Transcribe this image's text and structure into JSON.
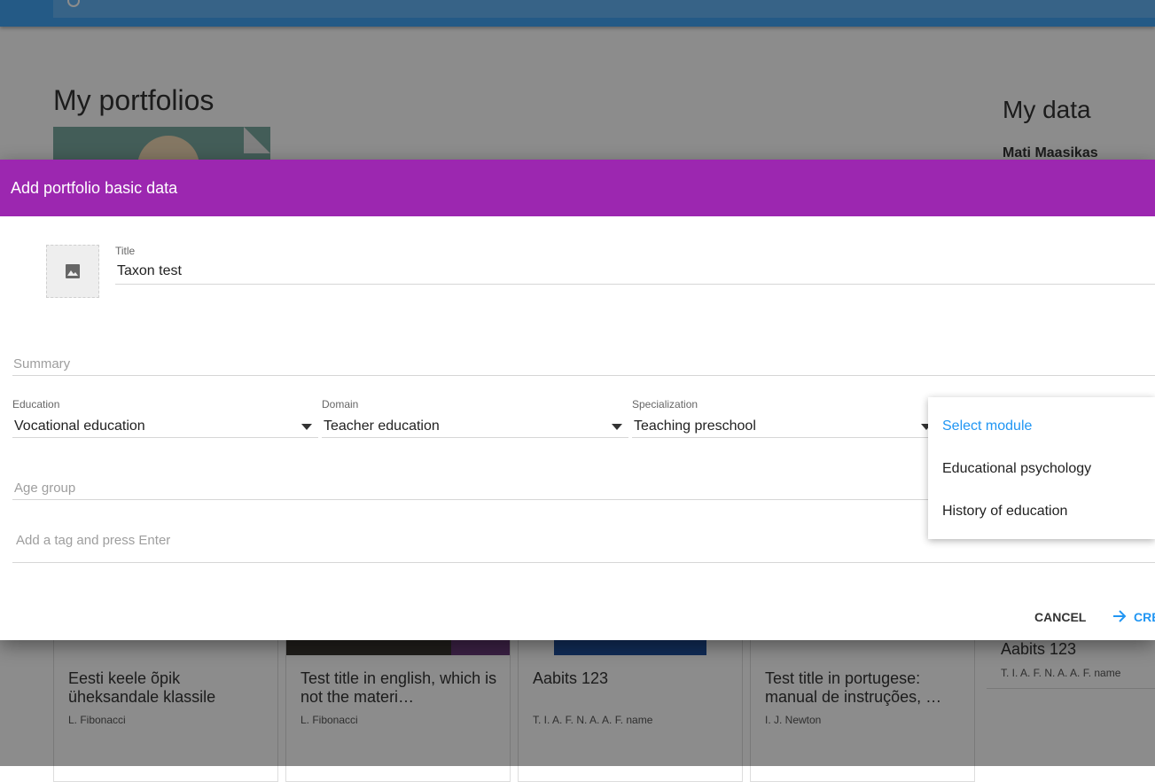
{
  "background": {
    "portfolios_title": "My portfolios",
    "my_data_title": "My data",
    "user_name": "Mati Maasikas",
    "cards": [
      {
        "title": "Eesti keele õpik üheksandale klassile",
        "author": "L. Fibonacci"
      },
      {
        "title": "Test title in english, which is not the materi…",
        "author": "L. Fibonacci"
      },
      {
        "title": "Aabits 123",
        "author": "T. I. A. F. N. A. A. F. name"
      },
      {
        "title": "Test title in portugese: manual de instruções, …",
        "author": "I. J. Newton"
      }
    ],
    "side_card": {
      "title": "Aabits 123",
      "author": "T. I. A. F. N. A. A. F. name"
    }
  },
  "dialog": {
    "title": "Add portfolio basic data",
    "title_field": {
      "label": "Title",
      "value": "Taxon test"
    },
    "summary_placeholder": "Summary",
    "education": {
      "label": "Education",
      "value": "Vocational education"
    },
    "domain": {
      "label": "Domain",
      "value": "Teacher education"
    },
    "specialization": {
      "label": "Specialization",
      "value": "Teaching preschool"
    },
    "age_group_placeholder": "Age group",
    "tag_placeholder": "Add a tag and press Enter",
    "module_menu": {
      "selected": "Select module",
      "options": [
        "Educational psychology",
        "History of education"
      ]
    },
    "buttons": {
      "cancel": "CANCEL",
      "create": "CRE"
    }
  },
  "colors": {
    "header": "#9c27b0",
    "topbar": "#42a5f5",
    "accent": "#2196f3"
  }
}
